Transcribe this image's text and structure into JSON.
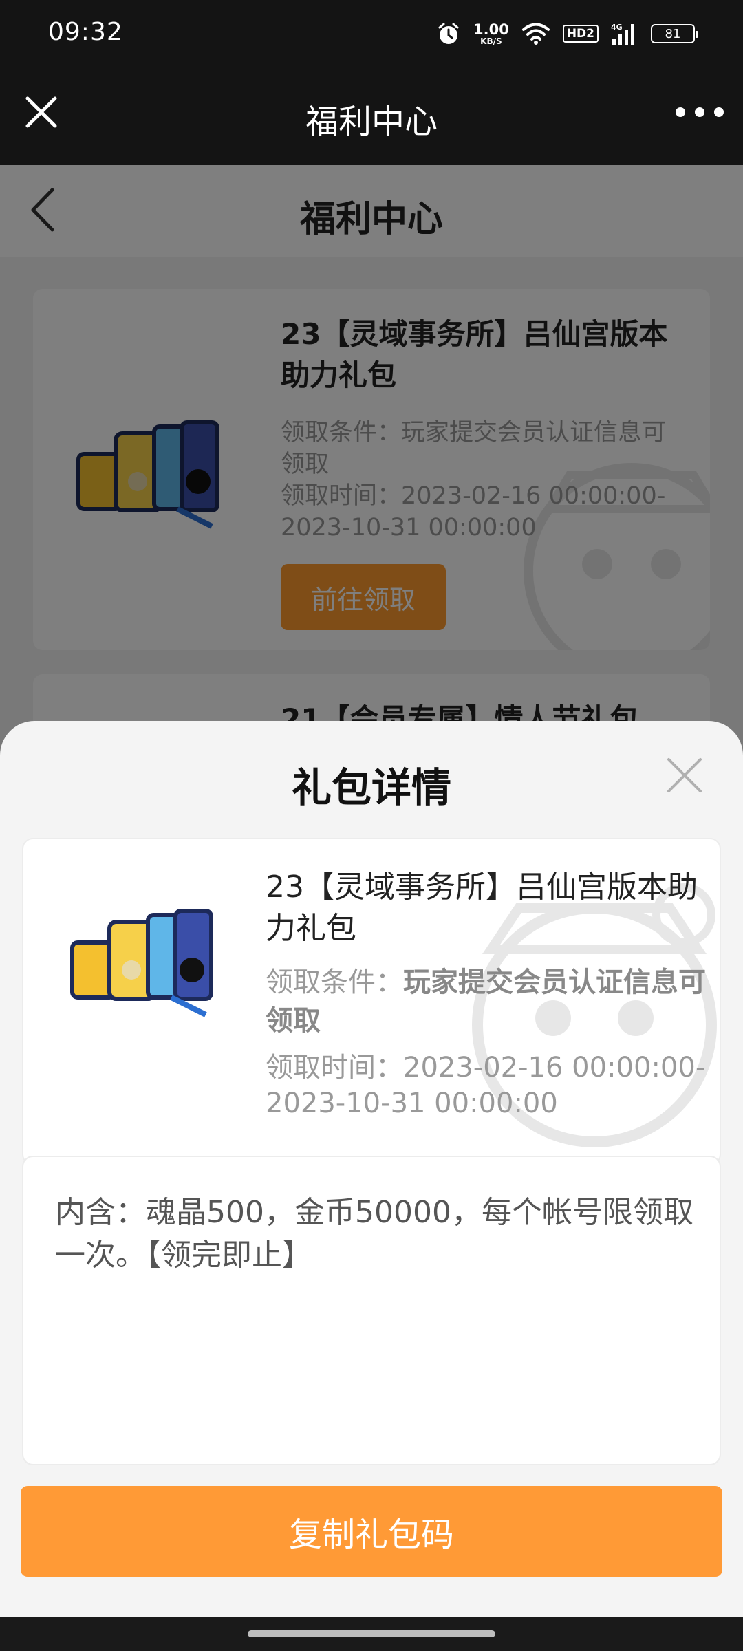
{
  "status_bar": {
    "time": "09:32",
    "net_speed_value": "1.00",
    "net_speed_unit": "KB/S",
    "hd_label": "HD2",
    "network_label": "4G",
    "battery": "81",
    "icons": [
      "alarm-icon",
      "wifi-icon",
      "signal-icon",
      "battery-icon"
    ]
  },
  "nav": {
    "title": "福利中心",
    "close_icon": "close-icon",
    "more_icon": "more-icon"
  },
  "page": {
    "title": "福利中心",
    "cards": [
      {
        "title": "23【灵域事务所】吕仙宫版本助力礼包",
        "condition": "领取条件：玩家提交会员认证信息可领取",
        "time": "领取时间：2023-02-16 00:00:00-2023-10-31 00:00:00",
        "button": "前往领取"
      },
      {
        "title": "21【会员专属】情人节礼包"
      }
    ]
  },
  "sheet": {
    "title": "礼包详情",
    "gift": {
      "title": "23【灵域事务所】吕仙宫版本助力礼包",
      "condition_label": "领取条件：",
      "condition_value": "玩家提交会员认证信息可领取",
      "time": "领取时间：2023-02-16 00:00:00-2023-10-31 00:00:00"
    },
    "content": "内含：魂晶500，金币50000，每个帐号限领取一次。【领完即止】",
    "copy_button": "复制礼包码"
  },
  "colors": {
    "accent": "#ff9a36",
    "dark_bar": "#141414"
  }
}
